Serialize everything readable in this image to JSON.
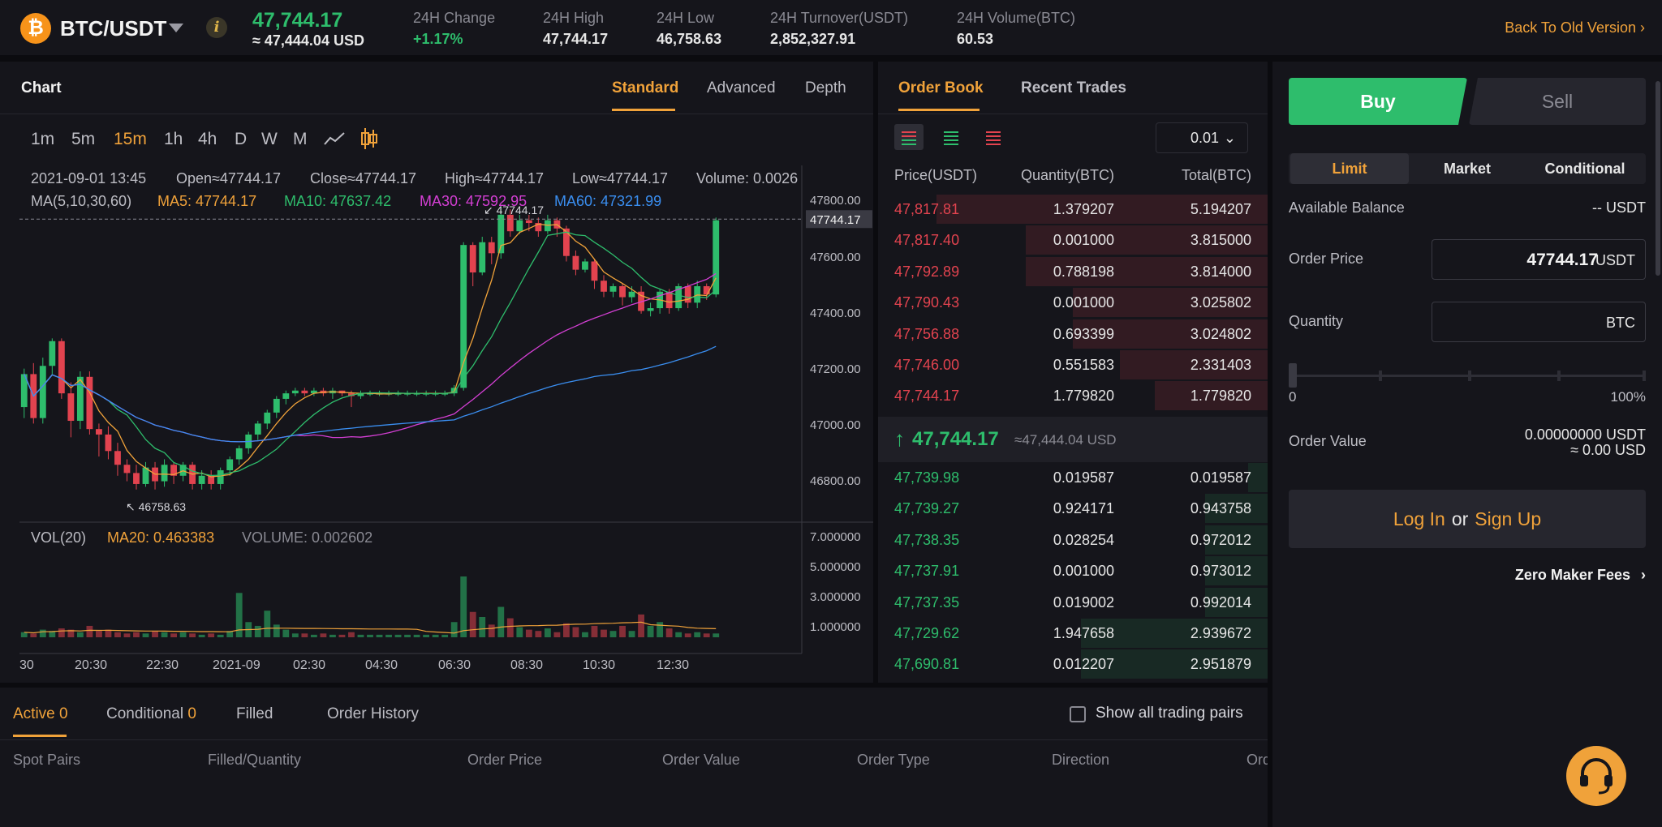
{
  "header": {
    "pair": "BTC/USDT",
    "last_price": "47,744.17",
    "last_price_usd": "≈ 47,444.04 USD",
    "stats": [
      {
        "label": "24H Change",
        "value": "+1.17%"
      },
      {
        "label": "24H High",
        "value": "47,744.17"
      },
      {
        "label": "24H Low",
        "value": "46,758.63"
      },
      {
        "label": "24H Turnover(USDT)",
        "value": "2,852,327.91"
      },
      {
        "label": "24H Volume(BTC)",
        "value": "60.53"
      }
    ],
    "back_link": "Back To Old Version",
    "back_chevron": "›"
  },
  "chart_panel": {
    "title": "Chart",
    "tabs": [
      "Standard",
      "Advanced",
      "Depth"
    ],
    "active_tab": "Standard",
    "intervals": [
      "1m",
      "5m",
      "15m",
      "1h",
      "4h",
      "D",
      "W",
      "M"
    ],
    "active_interval": "15m",
    "ohlc": {
      "time": "2021-09-01 13:45",
      "open": "Open≈47744.17",
      "close": "Close≈47744.17",
      "high": "High≈47744.17",
      "low": "Low≈47744.17",
      "volume": "Volume: 0.0026"
    },
    "ma_legend": {
      "name": "MA(5,10,30,60)",
      "ma5": "MA5: 47744.17",
      "ma10": "MA10: 47637.42",
      "ma30": "MA30: 47592.95",
      "ma60": "MA60: 47321.99"
    },
    "vol_legend": {
      "name": "VOL(20)",
      "ma20": "MA20: 0.463383",
      "volume": "VOLUME: 0.002602"
    },
    "colors": {
      "up": "#2ebd6c",
      "down": "#e2434f",
      "ma5": "#f0a23a",
      "ma10": "#2ebd6c",
      "ma30": "#d43fd4",
      "ma60": "#3a8ef0"
    }
  },
  "chart_data": {
    "type": "candlestick",
    "price_ticks": [
      "47800.00",
      "47600.00",
      "47400.00",
      "47200.00",
      "47000.00",
      "46800.00"
    ],
    "price_tick_values": [
      47800,
      47600,
      47400,
      47200,
      47000,
      46800
    ],
    "volume_ticks": [
      "7.000000",
      "5.000000",
      "3.000000",
      "1.000000"
    ],
    "volume_tick_values": [
      7,
      5,
      3,
      1
    ],
    "x_ticks": [
      "30",
      "20:30",
      "22:30",
      "2021-09",
      "02:30",
      "04:30",
      "06:30",
      "08:30",
      "10:30",
      "12:30"
    ],
    "current_price_label": "47744.17",
    "current_price": 47744.17,
    "high_marker": "47744.17",
    "high_value": 47744.17,
    "low_marker": "46758.63",
    "low_value": 46758.63,
    "price_range": [
      46650,
      47860
    ],
    "volume_range": [
      0,
      8
    ],
    "candles": [
      [
        47060,
        47180,
        47020,
        47200,
        0.4
      ],
      [
        47180,
        47020,
        47000,
        47220,
        0.3
      ],
      [
        47020,
        47210,
        47000,
        47240,
        0.6
      ],
      [
        47210,
        47300,
        47180,
        47310,
        0.5
      ],
      [
        47300,
        47110,
        47090,
        47310,
        0.7
      ],
      [
        47110,
        47010,
        46950,
        47150,
        0.6
      ],
      [
        47010,
        47170,
        46980,
        47190,
        0.4
      ],
      [
        47170,
        46980,
        46960,
        47190,
        0.9
      ],
      [
        46980,
        46960,
        46880,
        47000,
        0.5
      ],
      [
        46960,
        46900,
        46870,
        46990,
        0.6
      ],
      [
        46900,
        46850,
        46810,
        46930,
        0.4
      ],
      [
        46850,
        46820,
        46790,
        46870,
        0.3
      ],
      [
        46820,
        46780,
        46760,
        46850,
        0.4
      ],
      [
        46780,
        46840,
        46770,
        46860,
        0.3
      ],
      [
        46840,
        46790,
        46760,
        46860,
        0.5
      ],
      [
        46790,
        46850,
        46770,
        46870,
        0.4
      ],
      [
        46850,
        46810,
        46780,
        46860,
        0.3
      ],
      [
        46810,
        46850,
        46790,
        46860,
        0.4
      ],
      [
        46850,
        46780,
        46760,
        46860,
        0.3
      ],
      [
        46780,
        46810,
        46760,
        46830,
        0.2
      ],
      [
        46810,
        46780,
        46760,
        46830,
        0.3
      ],
      [
        46780,
        46830,
        46760,
        46840,
        0.2
      ],
      [
        46830,
        46870,
        46810,
        46880,
        0.5
      ],
      [
        46870,
        46910,
        46850,
        46920,
        3.5
      ],
      [
        46910,
        46960,
        46890,
        46970,
        1.2
      ],
      [
        46960,
        47000,
        46940,
        47010,
        0.9
      ],
      [
        47000,
        47040,
        46980,
        47050,
        2.1
      ],
      [
        47040,
        47090,
        47020,
        47100,
        1.0
      ],
      [
        47090,
        47110,
        47070,
        47120,
        0.6
      ],
      [
        47110,
        47120,
        47100,
        47130,
        0.3
      ],
      [
        47120,
        47110,
        47100,
        47130,
        0.3
      ],
      [
        47110,
        47120,
        47100,
        47130,
        0.2
      ],
      [
        47120,
        47110,
        47100,
        47130,
        0.3
      ],
      [
        47110,
        47120,
        47090,
        47130,
        0.2
      ],
      [
        47120,
        47110,
        47100,
        47120,
        0.2
      ],
      [
        47110,
        47100,
        47060,
        47120,
        0.4
      ],
      [
        47100,
        47110,
        47090,
        47120,
        0.2
      ],
      [
        47110,
        47110,
        47100,
        47120,
        0.2
      ],
      [
        47110,
        47110,
        47100,
        47120,
        0.2
      ],
      [
        47110,
        47110,
        47100,
        47120,
        0.2
      ],
      [
        47110,
        47110,
        47100,
        47120,
        0.2
      ],
      [
        47110,
        47110,
        47100,
        47120,
        0.2
      ],
      [
        47110,
        47110,
        47100,
        47120,
        0.2
      ],
      [
        47110,
        47110,
        47100,
        47120,
        0.2
      ],
      [
        47110,
        47110,
        47100,
        47120,
        0.2
      ],
      [
        47110,
        47110,
        47100,
        47120,
        0.2
      ],
      [
        47110,
        47130,
        47100,
        47140,
        1.2
      ],
      [
        47130,
        47650,
        47120,
        47660,
        4.8
      ],
      [
        47650,
        47550,
        47500,
        47660,
        2.0
      ],
      [
        47550,
        47660,
        47540,
        47680,
        1.6
      ],
      [
        47660,
        47620,
        47580,
        47680,
        1.0
      ],
      [
        47620,
        47760,
        47600,
        47790,
        2.4
      ],
      [
        47760,
        47700,
        47680,
        47780,
        1.5
      ],
      [
        47700,
        47740,
        47690,
        47760,
        0.8
      ],
      [
        47740,
        47730,
        47700,
        47760,
        0.6
      ],
      [
        47730,
        47700,
        47680,
        47750,
        0.5
      ],
      [
        47700,
        47740,
        47690,
        47760,
        0.7
      ],
      [
        47740,
        47710,
        47680,
        47750,
        0.4
      ],
      [
        47710,
        47610,
        47590,
        47720,
        1.1
      ],
      [
        47610,
        47560,
        47540,
        47630,
        0.8
      ],
      [
        47560,
        47590,
        47550,
        47600,
        0.4
      ],
      [
        47590,
        47520,
        47490,
        47600,
        0.9
      ],
      [
        47520,
        47480,
        47460,
        47540,
        0.6
      ],
      [
        47480,
        47500,
        47460,
        47510,
        0.5
      ],
      [
        47500,
        47460,
        47430,
        47510,
        0.9
      ],
      [
        47460,
        47480,
        47440,
        47500,
        0.5
      ],
      [
        47480,
        47410,
        47400,
        47500,
        1.8
      ],
      [
        47410,
        47420,
        47390,
        47440,
        0.9
      ],
      [
        47420,
        47480,
        47400,
        47490,
        1.2
      ],
      [
        47480,
        47420,
        47400,
        47490,
        0.7
      ],
      [
        47420,
        47500,
        47410,
        47510,
        0.4
      ],
      [
        47500,
        47440,
        47420,
        47510,
        0.3
      ],
      [
        47440,
        47500,
        47420,
        47520,
        0.4
      ],
      [
        47500,
        47470,
        47450,
        47510,
        0.3
      ],
      [
        47470,
        47740,
        47460,
        47750,
        0.3
      ]
    ]
  },
  "order_book": {
    "tabs": [
      "Order Book",
      "Recent Trades"
    ],
    "active_tab": "Order Book",
    "precision": "0.01",
    "headers": {
      "price": "Price(USDT)",
      "quantity": "Quantity(BTC)",
      "total": "Total(BTC)"
    },
    "asks": [
      {
        "price": "47,817.81",
        "qty": "1.379207",
        "total": "5.194207",
        "depth": 0.85
      },
      {
        "price": "47,817.40",
        "qty": "0.001000",
        "total": "3.815000",
        "depth": 0.62
      },
      {
        "price": "47,792.89",
        "qty": "0.788198",
        "total": "3.814000",
        "depth": 0.62
      },
      {
        "price": "47,790.43",
        "qty": "0.001000",
        "total": "3.025802",
        "depth": 0.5
      },
      {
        "price": "47,756.88",
        "qty": "0.693399",
        "total": "3.024802",
        "depth": 0.5
      },
      {
        "price": "47,746.00",
        "qty": "0.551583",
        "total": "2.331403",
        "depth": 0.38
      },
      {
        "price": "47,744.17",
        "qty": "1.779820",
        "total": "1.779820",
        "depth": 0.29
      }
    ],
    "mid_price": "47,744.17",
    "mid_usd": "≈47,444.04 USD",
    "bids": [
      {
        "price": "47,739.98",
        "qty": "0.019587",
        "total": "0.019587",
        "depth": 0.05
      },
      {
        "price": "47,739.27",
        "qty": "0.924171",
        "total": "0.943758",
        "depth": 0.16
      },
      {
        "price": "47,738.35",
        "qty": "0.028254",
        "total": "0.972012",
        "depth": 0.16
      },
      {
        "price": "47,737.91",
        "qty": "0.001000",
        "total": "0.973012",
        "depth": 0.16
      },
      {
        "price": "47,737.35",
        "qty": "0.019002",
        "total": "0.992014",
        "depth": 0.16
      },
      {
        "price": "47,729.62",
        "qty": "1.947658",
        "total": "2.939672",
        "depth": 0.48
      },
      {
        "price": "47,690.81",
        "qty": "0.012207",
        "total": "2.951879",
        "depth": 0.48
      }
    ]
  },
  "trade_panel": {
    "buy": "Buy",
    "sell": "Sell",
    "order_types": [
      "Limit",
      "Market",
      "Conditional"
    ],
    "active_order_type": "Limit",
    "available_balance_label": "Available Balance",
    "available_balance_value": "-- USDT",
    "order_price_label": "Order Price",
    "order_price_value": "47744.17",
    "order_price_unit": "USDT",
    "quantity_label": "Quantity",
    "quantity_value": "",
    "quantity_unit": "BTC",
    "slider_min": "0",
    "slider_max": "100%",
    "slider_value": 0,
    "order_value_label": "Order Value",
    "order_value": "0.00000000 USDT",
    "order_value_usd": "≈ 0.00 USD",
    "login": "Log In",
    "or": "or",
    "signup": "Sign Up",
    "zero_fees": "Zero Maker Fees",
    "zero_fees_chevron": "›"
  },
  "orders": {
    "tabs": [
      {
        "label": "Active",
        "count": "0"
      },
      {
        "label": "Conditional",
        "count": "0"
      },
      {
        "label": "Filled",
        "count": ""
      },
      {
        "label": "Order History",
        "count": ""
      }
    ],
    "active_tab": "Active",
    "show_all": "Show all trading pairs",
    "columns": [
      "Spot Pairs",
      "Filled/Quantity",
      "Order Price",
      "Order Value",
      "Order Type",
      "Direction",
      "Ord"
    ]
  }
}
